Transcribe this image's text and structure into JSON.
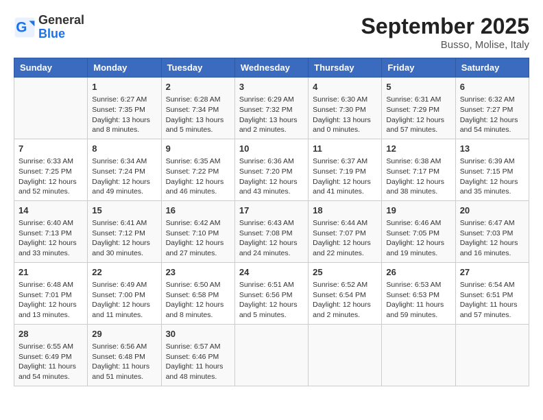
{
  "header": {
    "logo_general": "General",
    "logo_blue": "Blue",
    "month_title": "September 2025",
    "location": "Busso, Molise, Italy"
  },
  "days_of_week": [
    "Sunday",
    "Monday",
    "Tuesday",
    "Wednesday",
    "Thursday",
    "Friday",
    "Saturday"
  ],
  "weeks": [
    [
      {
        "day": "",
        "info": ""
      },
      {
        "day": "1",
        "info": "Sunrise: 6:27 AM\nSunset: 7:35 PM\nDaylight: 13 hours\nand 8 minutes."
      },
      {
        "day": "2",
        "info": "Sunrise: 6:28 AM\nSunset: 7:34 PM\nDaylight: 13 hours\nand 5 minutes."
      },
      {
        "day": "3",
        "info": "Sunrise: 6:29 AM\nSunset: 7:32 PM\nDaylight: 13 hours\nand 2 minutes."
      },
      {
        "day": "4",
        "info": "Sunrise: 6:30 AM\nSunset: 7:30 PM\nDaylight: 13 hours\nand 0 minutes."
      },
      {
        "day": "5",
        "info": "Sunrise: 6:31 AM\nSunset: 7:29 PM\nDaylight: 12 hours\nand 57 minutes."
      },
      {
        "day": "6",
        "info": "Sunrise: 6:32 AM\nSunset: 7:27 PM\nDaylight: 12 hours\nand 54 minutes."
      }
    ],
    [
      {
        "day": "7",
        "info": "Sunrise: 6:33 AM\nSunset: 7:25 PM\nDaylight: 12 hours\nand 52 minutes."
      },
      {
        "day": "8",
        "info": "Sunrise: 6:34 AM\nSunset: 7:24 PM\nDaylight: 12 hours\nand 49 minutes."
      },
      {
        "day": "9",
        "info": "Sunrise: 6:35 AM\nSunset: 7:22 PM\nDaylight: 12 hours\nand 46 minutes."
      },
      {
        "day": "10",
        "info": "Sunrise: 6:36 AM\nSunset: 7:20 PM\nDaylight: 12 hours\nand 43 minutes."
      },
      {
        "day": "11",
        "info": "Sunrise: 6:37 AM\nSunset: 7:19 PM\nDaylight: 12 hours\nand 41 minutes."
      },
      {
        "day": "12",
        "info": "Sunrise: 6:38 AM\nSunset: 7:17 PM\nDaylight: 12 hours\nand 38 minutes."
      },
      {
        "day": "13",
        "info": "Sunrise: 6:39 AM\nSunset: 7:15 PM\nDaylight: 12 hours\nand 35 minutes."
      }
    ],
    [
      {
        "day": "14",
        "info": "Sunrise: 6:40 AM\nSunset: 7:13 PM\nDaylight: 12 hours\nand 33 minutes."
      },
      {
        "day": "15",
        "info": "Sunrise: 6:41 AM\nSunset: 7:12 PM\nDaylight: 12 hours\nand 30 minutes."
      },
      {
        "day": "16",
        "info": "Sunrise: 6:42 AM\nSunset: 7:10 PM\nDaylight: 12 hours\nand 27 minutes."
      },
      {
        "day": "17",
        "info": "Sunrise: 6:43 AM\nSunset: 7:08 PM\nDaylight: 12 hours\nand 24 minutes."
      },
      {
        "day": "18",
        "info": "Sunrise: 6:44 AM\nSunset: 7:07 PM\nDaylight: 12 hours\nand 22 minutes."
      },
      {
        "day": "19",
        "info": "Sunrise: 6:46 AM\nSunset: 7:05 PM\nDaylight: 12 hours\nand 19 minutes."
      },
      {
        "day": "20",
        "info": "Sunrise: 6:47 AM\nSunset: 7:03 PM\nDaylight: 12 hours\nand 16 minutes."
      }
    ],
    [
      {
        "day": "21",
        "info": "Sunrise: 6:48 AM\nSunset: 7:01 PM\nDaylight: 12 hours\nand 13 minutes."
      },
      {
        "day": "22",
        "info": "Sunrise: 6:49 AM\nSunset: 7:00 PM\nDaylight: 12 hours\nand 11 minutes."
      },
      {
        "day": "23",
        "info": "Sunrise: 6:50 AM\nSunset: 6:58 PM\nDaylight: 12 hours\nand 8 minutes."
      },
      {
        "day": "24",
        "info": "Sunrise: 6:51 AM\nSunset: 6:56 PM\nDaylight: 12 hours\nand 5 minutes."
      },
      {
        "day": "25",
        "info": "Sunrise: 6:52 AM\nSunset: 6:54 PM\nDaylight: 12 hours\nand 2 minutes."
      },
      {
        "day": "26",
        "info": "Sunrise: 6:53 AM\nSunset: 6:53 PM\nDaylight: 11 hours\nand 59 minutes."
      },
      {
        "day": "27",
        "info": "Sunrise: 6:54 AM\nSunset: 6:51 PM\nDaylight: 11 hours\nand 57 minutes."
      }
    ],
    [
      {
        "day": "28",
        "info": "Sunrise: 6:55 AM\nSunset: 6:49 PM\nDaylight: 11 hours\nand 54 minutes."
      },
      {
        "day": "29",
        "info": "Sunrise: 6:56 AM\nSunset: 6:48 PM\nDaylight: 11 hours\nand 51 minutes."
      },
      {
        "day": "30",
        "info": "Sunrise: 6:57 AM\nSunset: 6:46 PM\nDaylight: 11 hours\nand 48 minutes."
      },
      {
        "day": "",
        "info": ""
      },
      {
        "day": "",
        "info": ""
      },
      {
        "day": "",
        "info": ""
      },
      {
        "day": "",
        "info": ""
      }
    ]
  ]
}
